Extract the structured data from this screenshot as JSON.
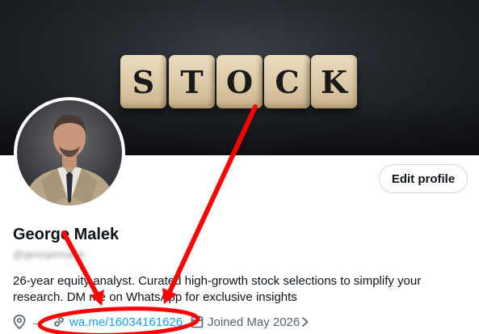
{
  "banner": {
    "dice_letters": [
      "S",
      "T",
      "O",
      "C",
      "K"
    ]
  },
  "profile": {
    "name": "George Malek",
    "handle": "@georgemalek",
    "bio_line1": "26-year equity analyst. Curated high-growth stock selections to simplify your",
    "bio_line2": "research. DM me on WhatsApp for exclusive insights",
    "edit_profile_label": "Edit profile",
    "location_text": "→",
    "website": "wa.me/16034161626",
    "joined": "Joined May 2026"
  },
  "icons": {
    "location": "location-pin-icon",
    "link": "link-icon",
    "calendar": "calendar-icon",
    "chevron": "chevron-right-icon"
  },
  "colors": {
    "link_blue": "#1d9bf0",
    "annotation_red": "#ff0000",
    "text_primary": "#0f1419",
    "text_secondary": "#536471"
  }
}
